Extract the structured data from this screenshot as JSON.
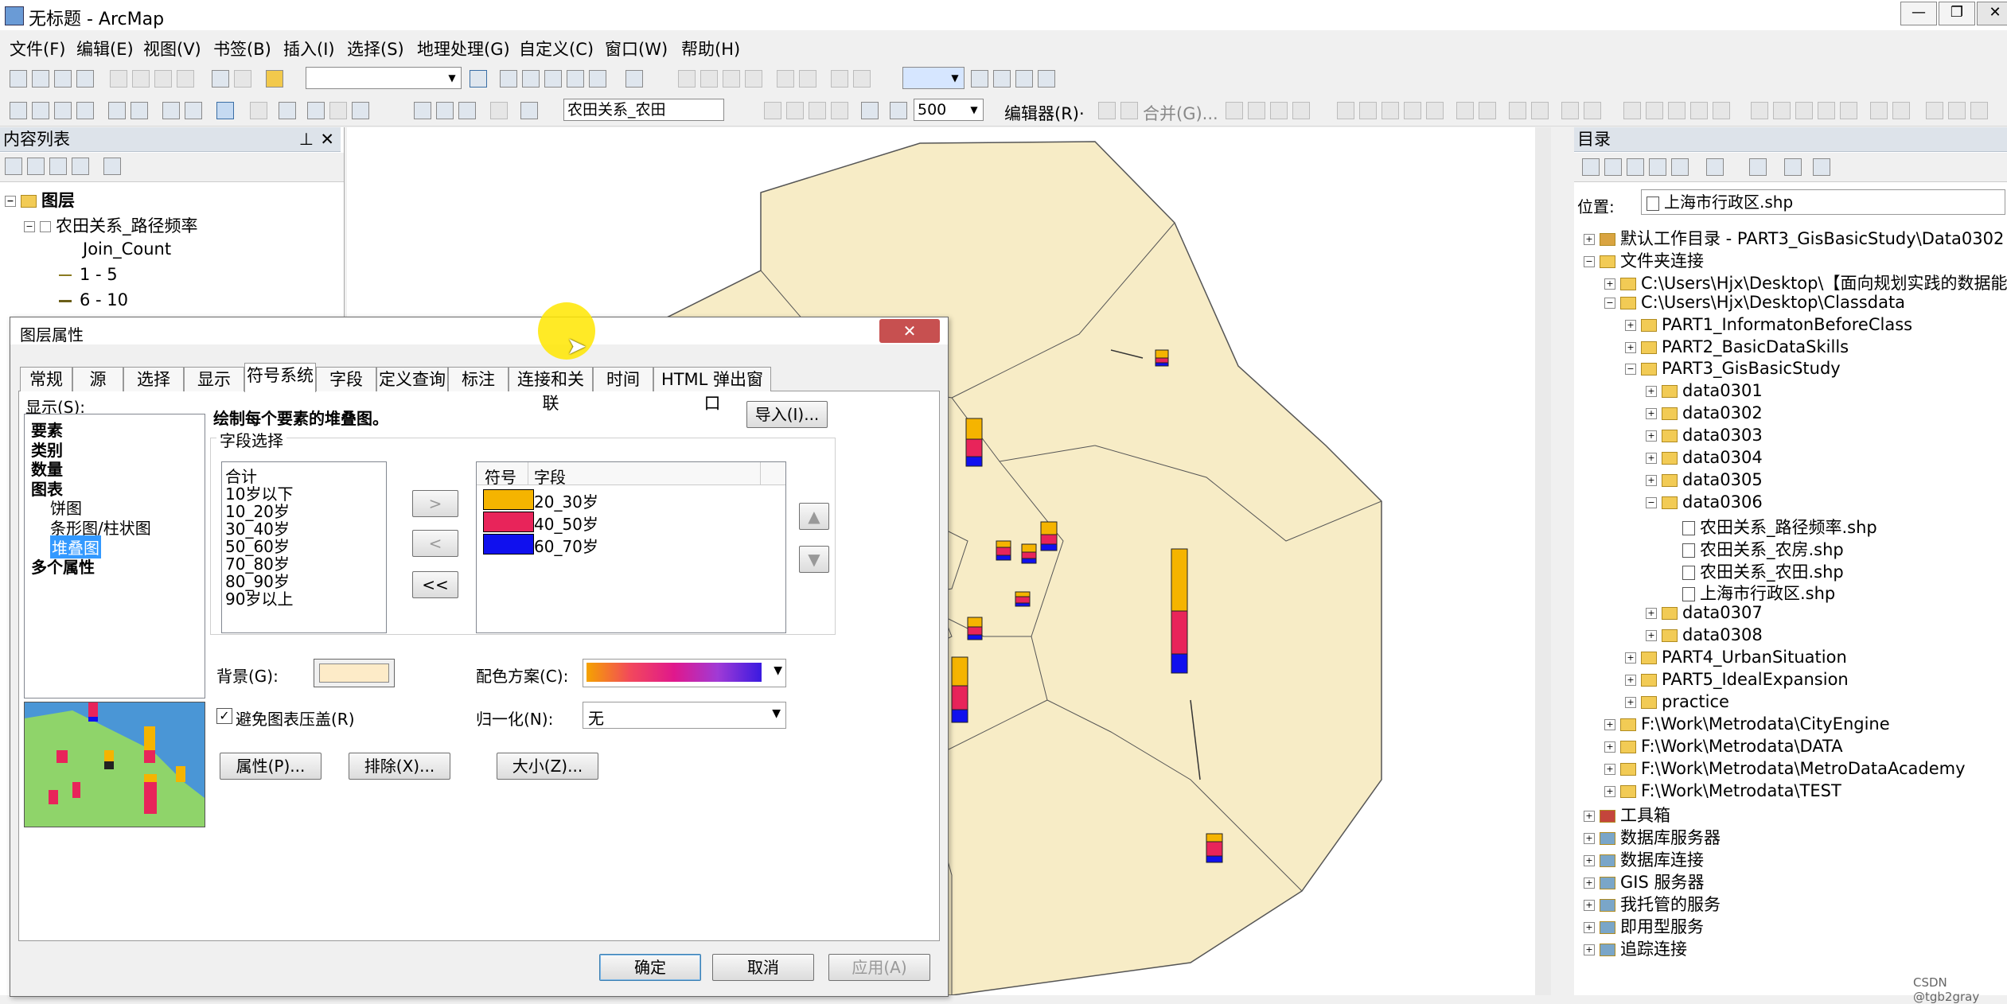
{
  "window": {
    "title": "无标题 - ArcMap"
  },
  "menubar": [
    "文件(F)",
    "编辑(E)",
    "视图(V)",
    "书签(B)",
    "插入(I)",
    "选择(S)",
    "地理处理(G)",
    "自定义(C)",
    "窗口(W)",
    "帮助(H)"
  ],
  "toolbar2": {
    "layer_combo": "农田关系_农田",
    "scale_value": "500",
    "editor_label": "编辑器(R)·",
    "merge_label": "合并(G)..."
  },
  "toc": {
    "header": "内容列表",
    "root": "图层",
    "layer": "农田关系_路径频率",
    "field": "Join_Count",
    "classes": [
      "1 - 5",
      "6 - 10"
    ]
  },
  "catalog": {
    "header": "目录",
    "location_label": "位置:",
    "location_value": "上海市行政区.shp",
    "tree": [
      {
        "label": "默认工作目录 - PART3_GisBasicStudy\\Data0302",
        "exp": "+",
        "icon": "home",
        "indent": 0
      },
      {
        "label": "文件夹连接",
        "exp": "−",
        "icon": "folder",
        "indent": 0
      },
      {
        "label": "C:\\Users\\Hjx\\Desktop\\【面向规划实践的数据能力培",
        "exp": "+",
        "icon": "folder",
        "indent": 1
      },
      {
        "label": "C:\\Users\\Hjx\\Desktop\\Classdata",
        "exp": "−",
        "icon": "folder",
        "indent": 1
      },
      {
        "label": "PART1_InformatonBeforeClass",
        "exp": "+",
        "icon": "folder",
        "indent": 2
      },
      {
        "label": "PART2_BasicDataSkills",
        "exp": "+",
        "icon": "folder",
        "indent": 2
      },
      {
        "label": "PART3_GisBasicStudy",
        "exp": "−",
        "icon": "folder",
        "indent": 2
      },
      {
        "label": "data0301",
        "exp": "+",
        "icon": "folder",
        "indent": 3
      },
      {
        "label": "data0302",
        "exp": "+",
        "icon": "folder",
        "indent": 3
      },
      {
        "label": "data0303",
        "exp": "+",
        "icon": "folder",
        "indent": 3
      },
      {
        "label": "data0304",
        "exp": "+",
        "icon": "folder",
        "indent": 3
      },
      {
        "label": "data0305",
        "exp": "+",
        "icon": "folder",
        "indent": 3
      },
      {
        "label": "data0306",
        "exp": "−",
        "icon": "folder",
        "indent": 3
      },
      {
        "label": "农田关系_路径频率.shp",
        "exp": "",
        "icon": "file",
        "indent": 4
      },
      {
        "label": "农田关系_农房.shp",
        "exp": "",
        "icon": "file",
        "indent": 4
      },
      {
        "label": "农田关系_农田.shp",
        "exp": "",
        "icon": "file",
        "indent": 4
      },
      {
        "label": "上海市行政区.shp",
        "exp": "",
        "icon": "file",
        "indent": 4
      },
      {
        "label": "data0307",
        "exp": "+",
        "icon": "folder",
        "indent": 3
      },
      {
        "label": "data0308",
        "exp": "+",
        "icon": "folder",
        "indent": 3
      },
      {
        "label": "PART4_UrbanSituation",
        "exp": "+",
        "icon": "folder",
        "indent": 2
      },
      {
        "label": "PART5_IdealExpansion",
        "exp": "+",
        "icon": "folder",
        "indent": 2
      },
      {
        "label": "practice",
        "exp": "+",
        "icon": "folder",
        "indent": 2
      },
      {
        "label": "F:\\Work\\Metrodata\\CityEngine",
        "exp": "+",
        "icon": "folder",
        "indent": 1
      },
      {
        "label": "F:\\Work\\Metrodata\\DATA",
        "exp": "+",
        "icon": "folder",
        "indent": 1
      },
      {
        "label": "F:\\Work\\Metrodata\\MetroDataAcademy",
        "exp": "+",
        "icon": "folder",
        "indent": 1
      },
      {
        "label": "F:\\Work\\Metrodata\\TEST",
        "exp": "+",
        "icon": "folder",
        "indent": 1
      },
      {
        "label": "工具箱",
        "exp": "+",
        "icon": "tool",
        "indent": 0
      },
      {
        "label": "数据库服务器",
        "exp": "+",
        "icon": "db",
        "indent": 0
      },
      {
        "label": "数据库连接",
        "exp": "+",
        "icon": "db",
        "indent": 0
      },
      {
        "label": "GIS 服务器",
        "exp": "+",
        "icon": "db",
        "indent": 0
      },
      {
        "label": "我托管的服务",
        "exp": "+",
        "icon": "db",
        "indent": 0
      },
      {
        "label": "即用型服务",
        "exp": "+",
        "icon": "db",
        "indent": 0
      },
      {
        "label": "追踪连接",
        "exp": "+",
        "icon": "db",
        "indent": 0
      }
    ]
  },
  "dialog": {
    "title": "图层属性",
    "tabs": [
      "常规",
      "源",
      "选择",
      "显示",
      "符号系统",
      "字段",
      "定义查询",
      "标注",
      "连接和关联",
      "时间",
      "HTML 弹出窗口"
    ],
    "active_tab": "符号系统",
    "show_label": "显示(S):",
    "show_items": [
      {
        "label": "要素",
        "bold": true,
        "indent": 0
      },
      {
        "label": "类别",
        "bold": true,
        "indent": 0
      },
      {
        "label": "数量",
        "bold": true,
        "indent": 0
      },
      {
        "label": "图表",
        "bold": true,
        "indent": 0
      },
      {
        "label": "饼图",
        "bold": false,
        "indent": 1
      },
      {
        "label": "条形图/柱状图",
        "bold": false,
        "indent": 1
      },
      {
        "label": "堆叠图",
        "bold": false,
        "indent": 1,
        "selected": true
      },
      {
        "label": "多个属性",
        "bold": true,
        "indent": 0
      }
    ],
    "description": "绘制每个要素的堆叠图。",
    "import_button": "导入(I)...",
    "field_group": "字段选择",
    "available_fields": [
      "合计",
      "10岁以下",
      "10_20岁",
      "30_40岁",
      "50_60岁",
      "70_80岁",
      "80_90岁",
      "90岁以上"
    ],
    "move_right": ">",
    "move_left": "<",
    "move_all_left": "<<",
    "col_symbol": "符号",
    "col_field": "字段",
    "selected_fields": [
      {
        "name": "20_30岁",
        "color": "#f5b400"
      },
      {
        "name": "40_50岁",
        "color": "#e8245a"
      },
      {
        "name": "60_70岁",
        "color": "#1010ee"
      }
    ],
    "background_label": "背景(G):",
    "background_color": "#fdebc8",
    "color_scheme_label": "配色方案(C):",
    "avoid_overlap_label": "避免图表压盖(R)",
    "avoid_overlap_checked": true,
    "normalize_label": "归一化(N):",
    "normalize_value": "无",
    "properties_button": "属性(P)...",
    "exclude_button": "排除(X)...",
    "size_button": "大小(Z)...",
    "ok_button": "确定",
    "cancel_button": "取消",
    "apply_button": "应用(A)"
  },
  "map": {
    "fill": "#f7ecc6",
    "charts": [
      {
        "segments": [
          0.4,
          0.35,
          0.25
        ]
      },
      {
        "segments": [
          0.45,
          0.35,
          0.2
        ]
      },
      {
        "segments": [
          0.45,
          0.4,
          0.15
        ]
      },
      {
        "segments": [
          0.5,
          0.3,
          0.2
        ]
      },
      {
        "segments": [
          0.4,
          0.4,
          0.2
        ]
      }
    ]
  },
  "watermark": "CSDN @tgb2gray"
}
